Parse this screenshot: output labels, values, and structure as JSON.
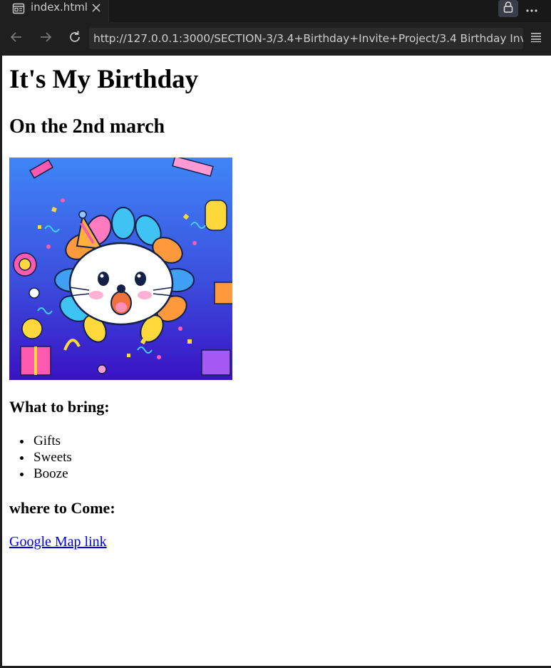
{
  "browser": {
    "tab": {
      "label": "index.html"
    },
    "address_bar": {
      "url": "http://127.0.0.1:3000/SECTION-3/3.4+Birthday+Invite+Project/3.4 Birthday Invite P"
    }
  },
  "page": {
    "heading": "It's My Birthday",
    "subheading": "On the 2nd march",
    "bring_heading": "What to bring:",
    "bring_items": [
      "Gifts",
      "Sweets",
      "Booze"
    ],
    "where_heading": "where to Come:",
    "map_link": "Google Map link"
  },
  "colors": {
    "chrome_bg": "#1f1f1f",
    "tab_strip_bg": "#181818",
    "address_bg": "#2b2b2b",
    "chrome_text": "#cccccc",
    "link": "#0000ee",
    "hero_top": "#3d7cf5",
    "hero_bottom": "#3a14c8"
  },
  "icons": [
    "browser-tab-icon",
    "close-icon",
    "lock-icon",
    "more-icon",
    "back-arrow-icon",
    "forward-arrow-icon",
    "reload-icon",
    "menu-icon"
  ]
}
